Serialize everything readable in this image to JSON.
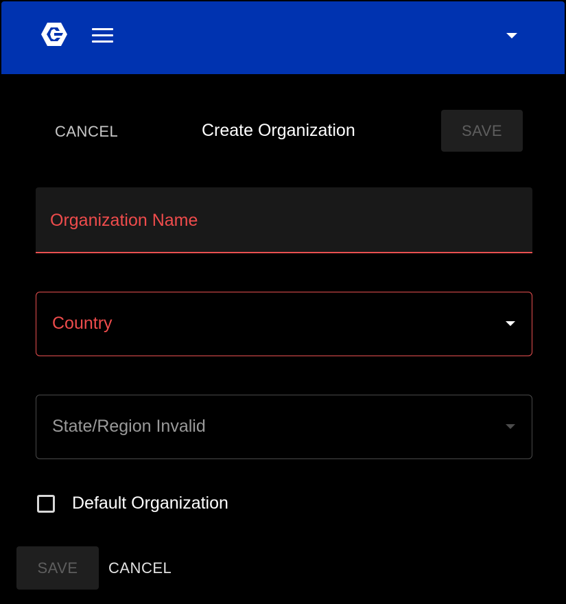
{
  "colors": {
    "appbar_bg": "#0033b0",
    "page_bg": "#000000",
    "error": "#ef4c4c",
    "field_bg": "#191919",
    "disabled_button_bg": "#1f1f1f",
    "disabled_button_text": "#5e5e5e"
  },
  "appbar": {
    "logo_icon": "brand-logo-icon",
    "menu_icon": "hamburger-menu-icon",
    "dropdown_icon": "caret-down-icon"
  },
  "dialog": {
    "title": "Create Organization",
    "cancel_label": "CANCEL",
    "save_label": "SAVE"
  },
  "form": {
    "organization_name": {
      "label": "Organization Name",
      "value": "",
      "state": "error"
    },
    "country": {
      "label": "Country",
      "value": "",
      "state": "error"
    },
    "state_region": {
      "label": "State/Region Invalid",
      "value": "",
      "state": "disabled"
    },
    "default_organization": {
      "label": "Default Organization",
      "checked": false
    }
  },
  "footer": {
    "save_label": "SAVE",
    "cancel_label": "CANCEL"
  }
}
